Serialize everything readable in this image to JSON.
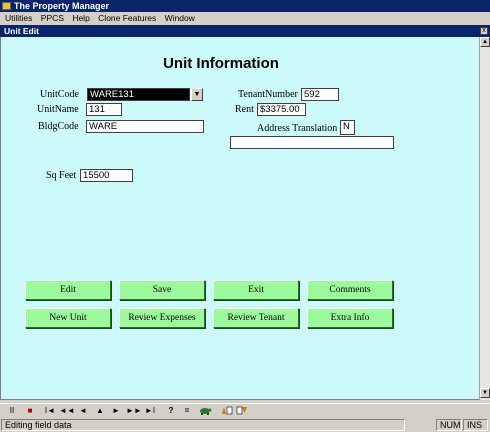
{
  "app": {
    "title": "The Property Manager"
  },
  "menubar": {
    "items": [
      "Utilities",
      "PPCS",
      "Help",
      "Clone Features",
      "Window"
    ]
  },
  "window": {
    "title": "Unit Edit",
    "close_glyph": "x"
  },
  "form": {
    "title": "Unit Information",
    "fields": {
      "unit_code": {
        "label": "UnitCode",
        "value": "WARE131"
      },
      "unit_name": {
        "label": "UnitName",
        "value": "131"
      },
      "bldg_code": {
        "label": "BldgCode",
        "value": "WARE"
      },
      "tenant_number": {
        "label": "TenantNumber",
        "value": "592"
      },
      "rent": {
        "label": "Rent",
        "value": "$3375.00"
      },
      "address_translation": {
        "label": "Address Translation",
        "value": "N",
        "detail": ""
      },
      "sq_feet": {
        "label": "Sq Feet",
        "value": "15500"
      }
    },
    "buttons": {
      "edit": "Edit",
      "save": "Save",
      "exit": "Exit",
      "comments": "Comments",
      "new_unit": "New Unit",
      "review_expenses": "Review Expenses",
      "review_tenant": "Review Tenant",
      "extra_info": "Extra Info"
    }
  },
  "navbar": {
    "icons": [
      "pause-icon",
      "stop-icon",
      "first-record-icon",
      "prev-page-icon",
      "prev-record-icon",
      "up-icon",
      "next-record-icon",
      "next-page-icon",
      "last-record-icon",
      "help-query-icon",
      "equals-icon",
      "turtle-icon",
      "sort-icon",
      "filter-icon"
    ],
    "glyphs": {
      "pause": "II",
      "stop": "■",
      "first": "I◄",
      "prev_page": "◄◄",
      "prev": "◄",
      "up": "▲",
      "next": "►",
      "next_page": "►►",
      "last": "►I",
      "query": "?",
      "equals": "="
    }
  },
  "statusbar": {
    "message": "Editing field data",
    "num": "NUM",
    "ins": "INS"
  },
  "colors": {
    "form_bg": "#ccfafa",
    "button_bg": "#9cfa9c",
    "titlebar": "#0a246a"
  }
}
